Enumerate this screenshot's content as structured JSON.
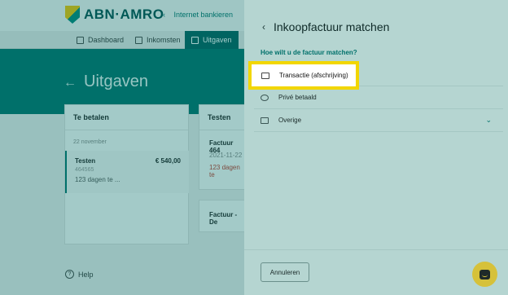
{
  "header": {
    "logo_text": "ABN·AMRO",
    "back_link": "Internet bankieren"
  },
  "nav": {
    "tabs": [
      {
        "label": "Dashboard",
        "icon": "dashboard-icon"
      },
      {
        "label": "Inkomsten",
        "icon": "document-icon"
      },
      {
        "label": "Uitgaven",
        "icon": "wallet-icon",
        "active": true
      }
    ]
  },
  "hero": {
    "title": "Uitgaven"
  },
  "te_betalen": {
    "title": "Te betalen",
    "date": "22 november",
    "item": {
      "name": "Testen",
      "amount": "€ 540,00",
      "ref": "464565",
      "days": "123 dagen te ..."
    }
  },
  "testen_card": {
    "title": "Testen",
    "invoice_title": "Factuur 464",
    "invoice_date": "2021-11-22",
    "invoice_days": "123 dagen te"
  },
  "factuur_card": {
    "title": "Factuur - De"
  },
  "help": {
    "label": "Help"
  },
  "panel": {
    "title": "Inkoopfactuur matchen",
    "question": "Hoe wilt u de factuur matchen?",
    "options": [
      {
        "label": "Transactie (afschrijving)",
        "icon": "card-icon"
      },
      {
        "label": "Privé betaald",
        "icon": "coins-icon"
      },
      {
        "label": "Overige",
        "icon": "folder-icon"
      }
    ],
    "cancel_label": "Annuleren"
  },
  "colors": {
    "brand_green": "#00716b",
    "highlight_yellow": "#f2d600",
    "chat_yellow": "#d6c13a"
  }
}
